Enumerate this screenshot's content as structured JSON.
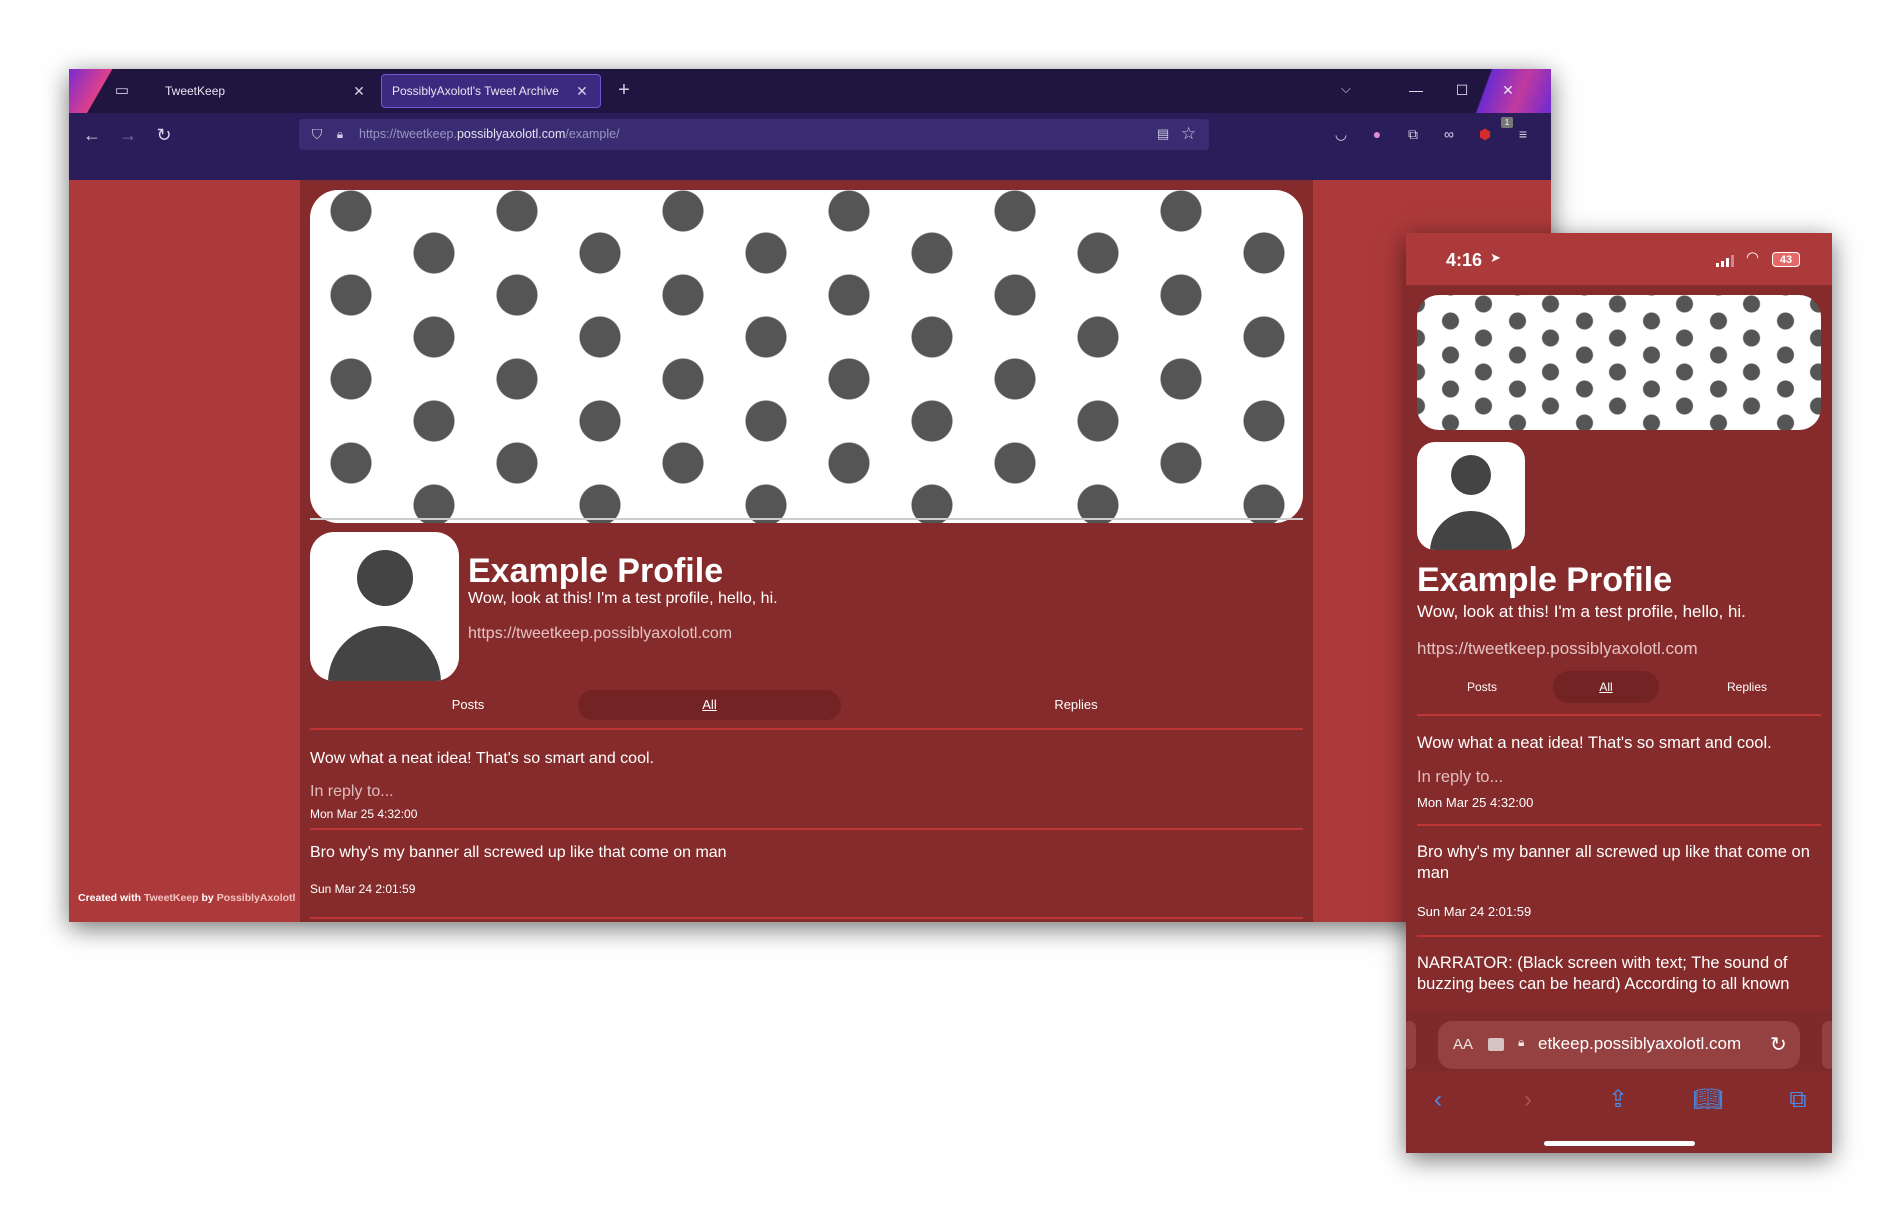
{
  "desktop": {
    "tabs": [
      {
        "label": "TweetKeep",
        "active": false
      },
      {
        "label": "PossiblyAxolotl's Tweet Archive",
        "active": true
      }
    ],
    "new_tab_glyph": "+",
    "tab_list_glyph": "⌵",
    "window_controls": {
      "minimize": "—",
      "maximize": "☐",
      "close": "✕"
    },
    "nav": {
      "back": "←",
      "forward": "→",
      "reload": "↻"
    },
    "url": {
      "prefix": "https://tweetkeep.",
      "host": "possiblyaxolotl.com",
      "path": "/example/"
    },
    "icons": [
      "shield-icon",
      "lock-icon",
      "reader-view-icon",
      "bookmark-star-icon",
      "pocket-icon",
      "profile-icon",
      "extensions-icon",
      "glasses-extension-icon",
      "ublock-icon",
      "menu-icon"
    ],
    "ext_badge": "1",
    "credit": {
      "prefix": "Created with ",
      "app": "TweetKeep",
      "by": " by ",
      "author": "PossiblyAxolotl"
    },
    "profile": {
      "name": "Example Profile",
      "bio": "Wow, look at this! I'm a test profile, hello, hi.",
      "link": "https://tweetkeep.possiblyaxolotl.com"
    },
    "filter_tabs": [
      "Posts",
      "All",
      "Replies"
    ],
    "selected_tab": "All",
    "posts": [
      {
        "text": "Wow what a neat idea! That's so smart and cool.",
        "reply": "In reply to...",
        "date": "Mon Mar 25 4:32:00"
      },
      {
        "text": "Bro why's my banner all screwed up like that come on man",
        "reply": "",
        "date": "Sun Mar 24 2:01:59"
      }
    ]
  },
  "phone": {
    "status": {
      "time": "4:16",
      "battery": "43"
    },
    "profile": {
      "name": "Example Profile",
      "bio": "Wow, look at this! I'm a test profile, hello, hi.",
      "link": "https://tweetkeep.possiblyaxolotl.com"
    },
    "filter_tabs": [
      "Posts",
      "All",
      "Replies"
    ],
    "posts": [
      {
        "text": "Wow what a neat idea! That's so smart and cool.",
        "reply": "In reply to...",
        "date": "Mon Mar 25 4:32:00"
      },
      {
        "text": "Bro why's my banner all screwed up like that come on man",
        "reply": "",
        "date": "Sun Mar 24 2:01:59"
      },
      {
        "text": "NARRATOR: (Black screen with text; The sound of buzzing bees can be heard) According to all known",
        "reply": "",
        "date": ""
      }
    ],
    "address_bar": {
      "aa": "AA",
      "url": "etkeep.possiblyaxolotl.com"
    },
    "toolbar_icons": [
      "back-icon",
      "forward-icon",
      "share-icon",
      "bookmarks-icon",
      "tabs-icon"
    ]
  }
}
